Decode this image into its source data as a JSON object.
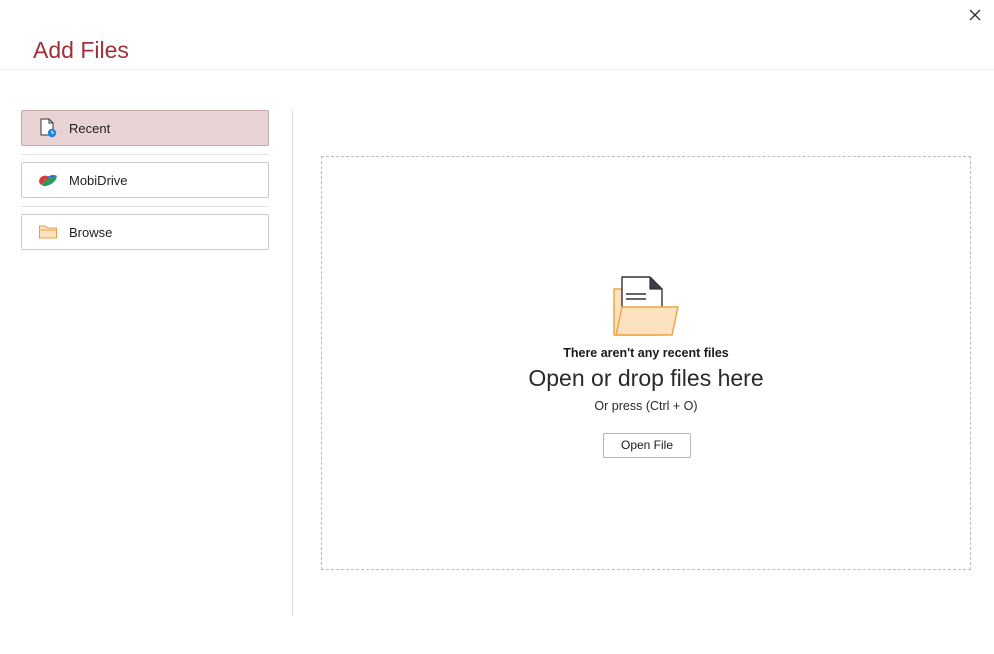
{
  "dialog": {
    "title": "Add Files",
    "close_icon": "close-icon"
  },
  "sidebar": {
    "items": [
      {
        "label": "Recent",
        "icon": "recent-file-icon",
        "selected": true
      },
      {
        "label": "MobiDrive",
        "icon": "mobidrive-logo-icon",
        "selected": false
      },
      {
        "label": "Browse",
        "icon": "folder-icon",
        "selected": false
      }
    ]
  },
  "main": {
    "empty_state": {
      "icon": "document-folder-icon",
      "title": "There aren't any recent files",
      "drop_text": "Open or drop files here",
      "shortcut_text": "Or press (Ctrl + O)",
      "open_button_label": "Open File"
    }
  },
  "colors": {
    "title": "#a1303a",
    "selected_item_bg": "#e8d3d4",
    "folder_fill": "#fde2bf",
    "folder_stroke": "#f0a340",
    "accent_blue": "#1e88d8"
  }
}
